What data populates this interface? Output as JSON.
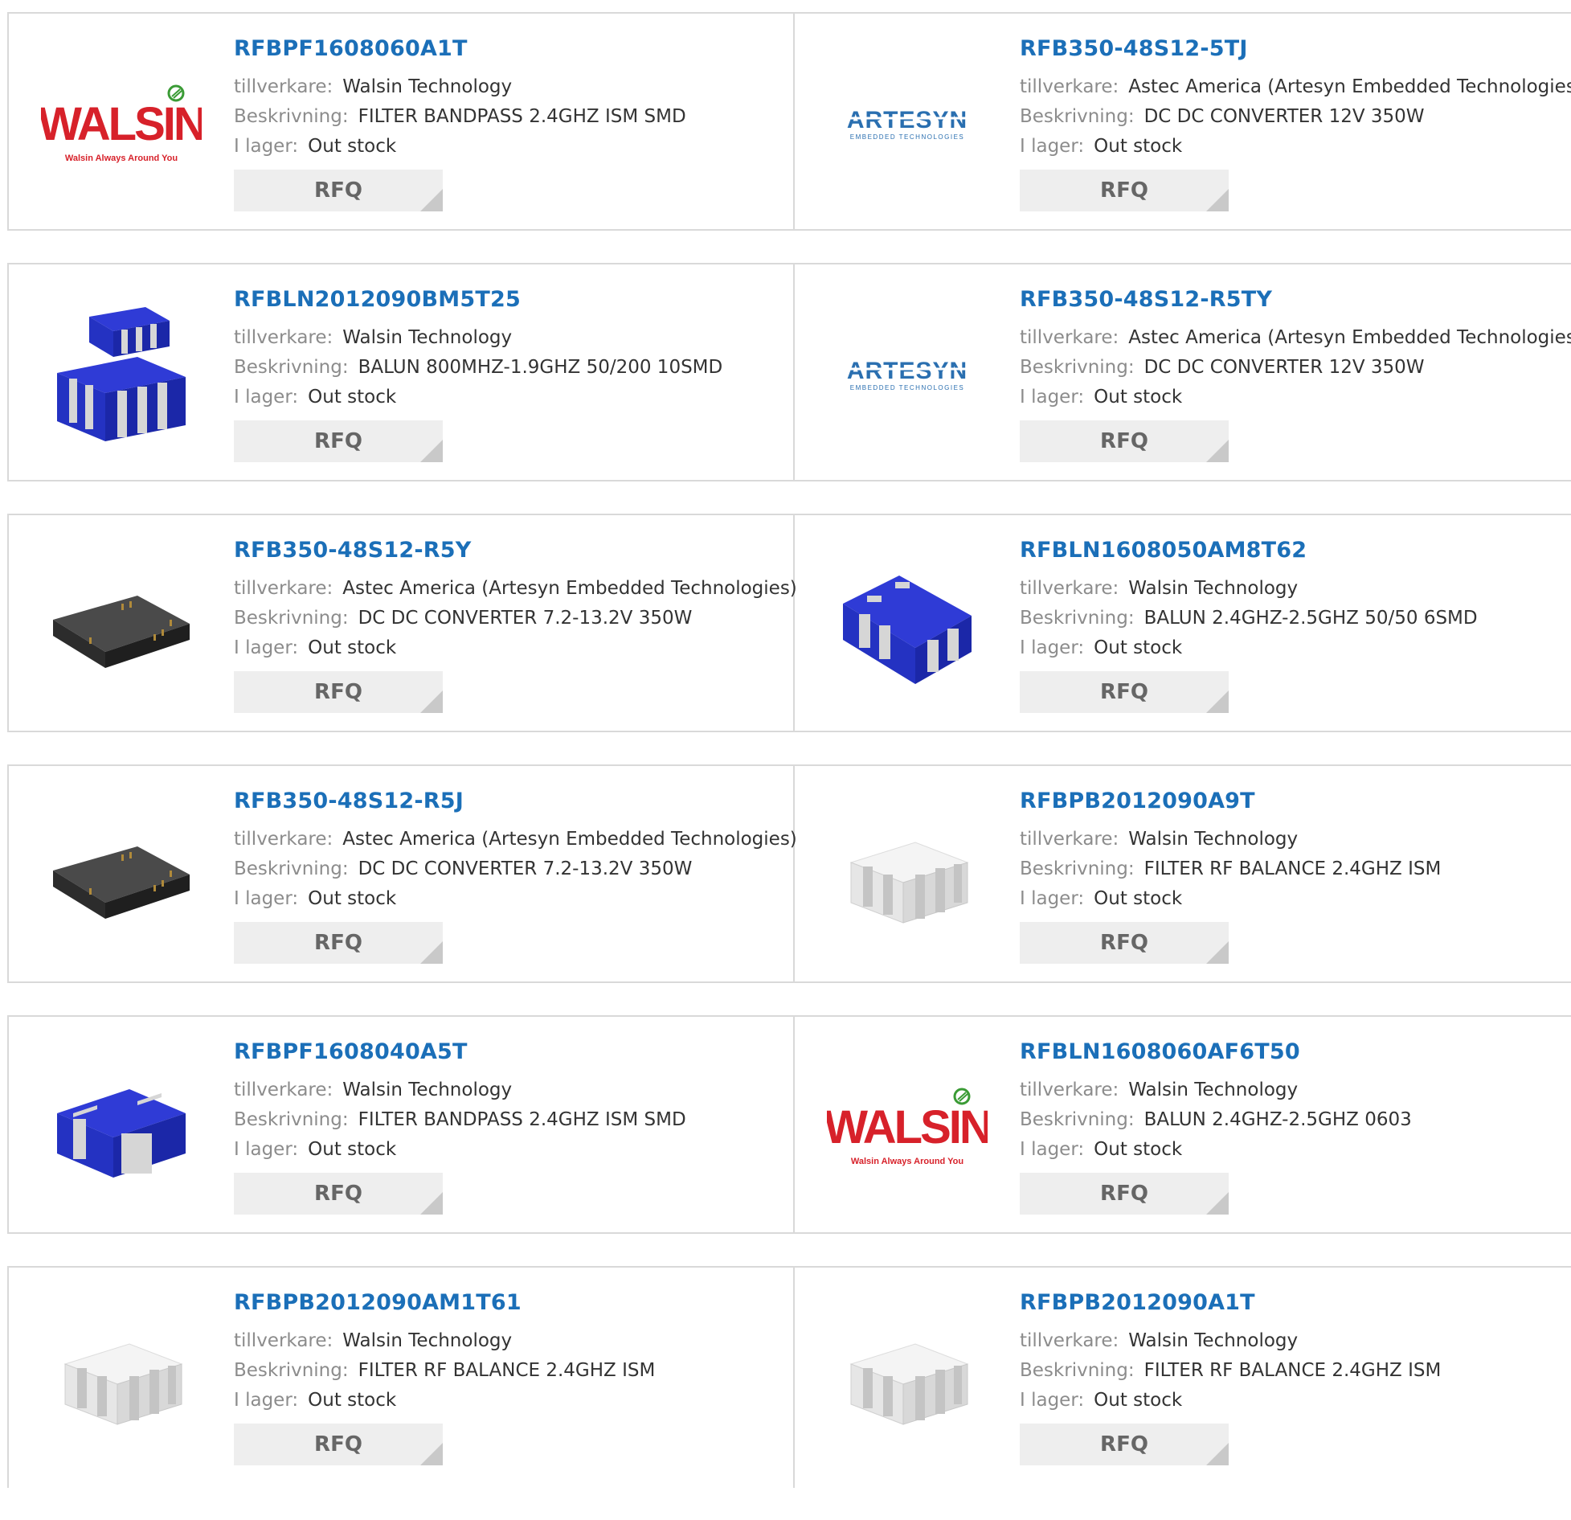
{
  "labels": {
    "manufacturer": "tillverkare:",
    "description": "Beskrivning:",
    "stock": "I lager:",
    "rfq": "RFQ"
  },
  "logos": {
    "walsin": {
      "word": "WALSIN",
      "tagline": "Walsin Always Around You",
      "color": "#d7212a",
      "accent": "#3a9b35"
    },
    "artesyn": {
      "word": "ARTESYN",
      "tagline": "EMBEDDED TECHNOLOGIES",
      "color": "#2a6fb0"
    }
  },
  "products": [
    {
      "part": "RFBPF1608060A1T",
      "manufacturer": "Walsin Technology",
      "description": "FILTER BANDPASS 2.4GHZ ISM SMD",
      "stock": "Out stock",
      "image": "walsin-logo"
    },
    {
      "part": "RFB350-48S12-5TJ",
      "manufacturer": "Astec America (Artesyn Embedded Technologies)",
      "description": "DC DC CONVERTER 12V 350W",
      "stock": "Out stock",
      "image": "artesyn-logo"
    },
    {
      "part": "RFBLN2012090BM5T25",
      "manufacturer": "Walsin Technology",
      "description": "BALUN 800MHZ-1.9GHZ 50/200 10SMD",
      "stock": "Out stock",
      "image": "blue-balun-stack"
    },
    {
      "part": "RFB350-48S12-R5TY",
      "manufacturer": "Astec America (Artesyn Embedded Technologies)",
      "description": "DC DC CONVERTER 12V 350W",
      "stock": "Out stock",
      "image": "artesyn-logo"
    },
    {
      "part": "RFB350-48S12-R5Y",
      "manufacturer": "Astec America (Artesyn Embedded Technologies)",
      "description": "DC DC CONVERTER 7.2-13.2V 350W",
      "stock": "Out stock",
      "image": "black-module"
    },
    {
      "part": "RFBLN1608050AM8T62",
      "manufacturer": "Walsin Technology",
      "description": "BALUN 2.4GHZ-2.5GHZ 50/50 6SMD",
      "stock": "Out stock",
      "image": "blue-chip-6"
    },
    {
      "part": "RFB350-48S12-R5J",
      "manufacturer": "Astec America (Artesyn Embedded Technologies)",
      "description": "DC DC CONVERTER 7.2-13.2V 350W",
      "stock": "Out stock",
      "image": "black-module"
    },
    {
      "part": "RFBPB2012090A9T",
      "manufacturer": "Walsin Technology",
      "description": "FILTER RF BALANCE 2.4GHZ ISM",
      "stock": "Out stock",
      "image": "white-chip"
    },
    {
      "part": "RFBPF1608040A5T",
      "manufacturer": "Walsin Technology",
      "description": "FILTER BANDPASS 2.4GHZ ISM SMD",
      "stock": "Out stock",
      "image": "blue-chip-4"
    },
    {
      "part": "RFBLN1608060AF6T50",
      "manufacturer": "Walsin Technology",
      "description": "BALUN 2.4GHZ-2.5GHZ 0603",
      "stock": "Out stock",
      "image": "walsin-logo"
    },
    {
      "part": "RFBPB2012090AM1T61",
      "manufacturer": "Walsin Technology",
      "description": "FILTER RF BALANCE 2.4GHZ ISM",
      "stock": "Out stock",
      "image": "white-chip"
    },
    {
      "part": "RFBPB2012090A1T",
      "manufacturer": "Walsin Technology",
      "description": "FILTER RF BALANCE 2.4GHZ ISM",
      "stock": "Out stock",
      "image": "white-chip"
    }
  ]
}
